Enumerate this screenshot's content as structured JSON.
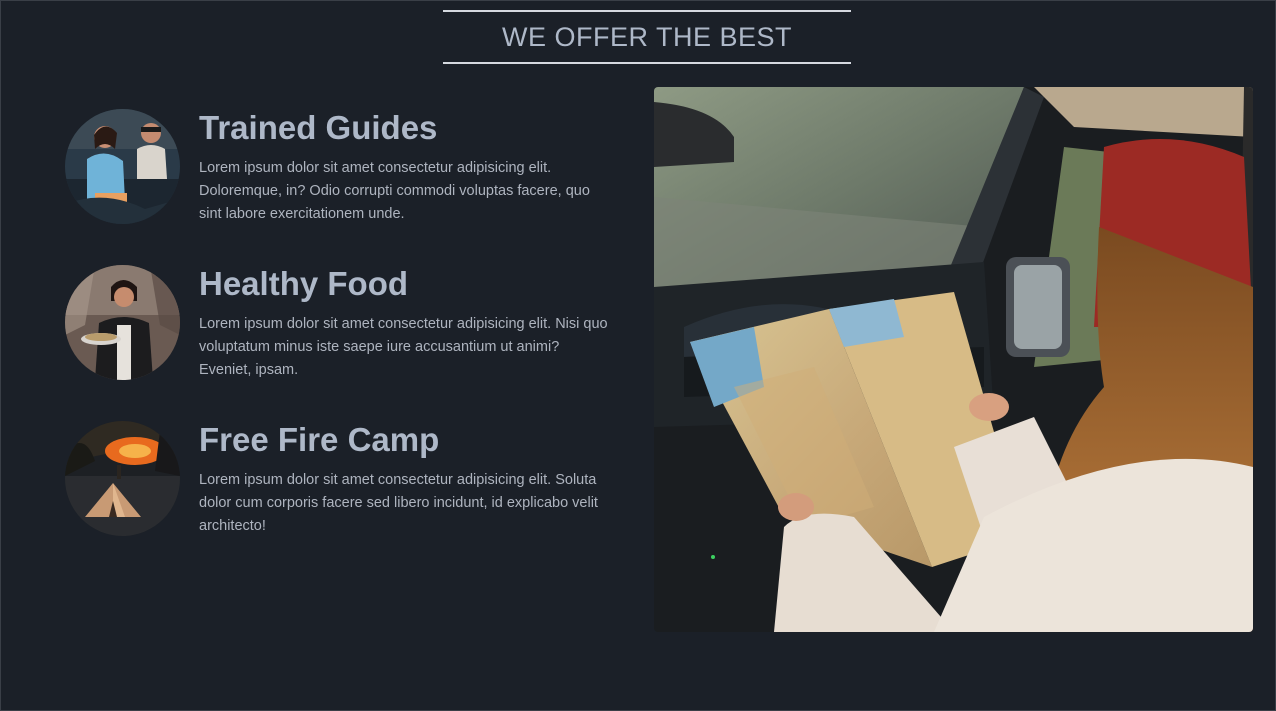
{
  "section": {
    "heading": "WE OFFER THE BEST"
  },
  "features": [
    {
      "title": "Trained Guides",
      "description": "Lorem ipsum dolor sit amet consectetur adipisicing elit. Doloremque, in? Odio corrupti commodi voluptas facere, quo sint labore exercitationem unde."
    },
    {
      "title": "Healthy Food",
      "description": "Lorem ipsum dolor sit amet consectetur adipisicing elit. Nisi quo voluptatum minus iste saepe iure accusantium ut animi? Eveniet, ipsam."
    },
    {
      "title": "Free Fire Camp",
      "description": "Lorem ipsum dolor sit amet consectetur adipisicing elit. Soluta dolor cum corporis facere sed libero incidunt, id explicabo velit architecto!"
    }
  ],
  "colors": {
    "background": "#1b2028",
    "heading_text": "#aeb8c8",
    "body_text": "#aeb4bf",
    "rule": "#d5d9e0"
  }
}
